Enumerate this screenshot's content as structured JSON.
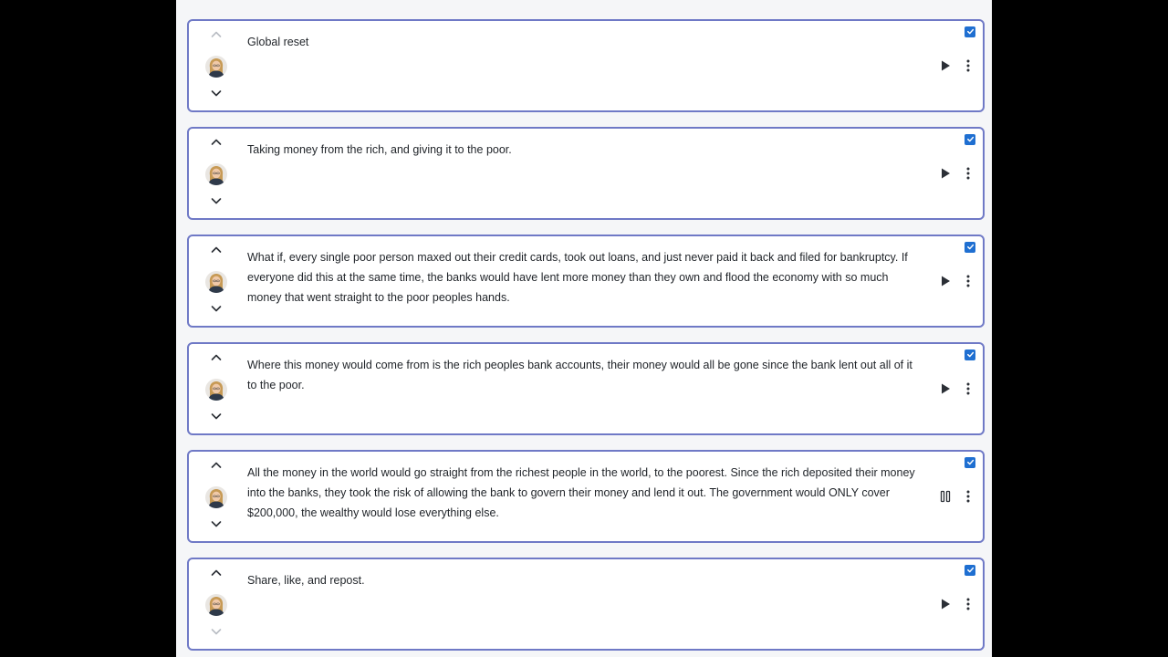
{
  "cards": [
    {
      "text": "Global reset",
      "state": "play",
      "up_enabled": false,
      "down_enabled": true,
      "checked": true
    },
    {
      "text": "Taking money from the rich, and giving it to the poor.",
      "state": "play",
      "up_enabled": true,
      "down_enabled": true,
      "checked": true
    },
    {
      "text": "What if, every single poor person maxed out their credit cards, took out loans, and just never paid it back and filed for bankruptcy. If everyone did this at the same time, the banks would have lent more money than they own and flood the economy with so much money that went straight to the poor peoples hands.",
      "state": "play",
      "up_enabled": true,
      "down_enabled": true,
      "checked": true
    },
    {
      "text": "Where this money would come from is the rich peoples bank accounts, their money would all be gone since the bank lent out all of it to the poor.",
      "state": "play",
      "up_enabled": true,
      "down_enabled": true,
      "checked": true
    },
    {
      "text": "All the money in the world would go straight from the richest people in the world, to the poorest. Since the rich deposited their money into the banks, they took the risk of allowing the bank to govern their money and lend it out. The government would ONLY cover $200,000, the wealthy would lose everything else.",
      "state": "pause",
      "up_enabled": true,
      "down_enabled": true,
      "checked": true
    },
    {
      "text": "Share, like, and repost.",
      "state": "play",
      "up_enabled": true,
      "down_enabled": false,
      "checked": true
    }
  ],
  "icons": {
    "up": "chevron-up-icon",
    "down": "chevron-down-icon",
    "play": "play-icon",
    "pause": "pause-icon",
    "more": "more-vertical-icon",
    "check": "checkbox-checked-icon",
    "avatar": "avatar"
  },
  "colors": {
    "card_border": "#6f79c6",
    "checkbox": "#1f6fd1",
    "icon": "#2b2f36"
  }
}
